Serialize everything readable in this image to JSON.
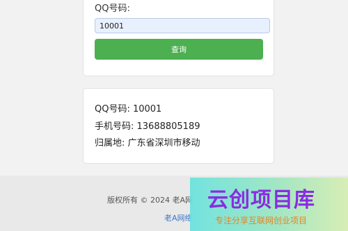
{
  "form": {
    "label": "QQ号码:",
    "input_value": "10001",
    "button_label": "查询"
  },
  "result": {
    "qq": "QQ号码: 10001",
    "phone": "手机号码: 13688805189",
    "location": "归属地: 广东省深圳市移动"
  },
  "footer": {
    "copyright": "版权所有 © 2024 老A网",
    "link_text": "老A网络"
  },
  "watermark": {
    "title": "云创项目库",
    "subtitle": "专注分享互联网创业项目"
  },
  "colors": {
    "button": "#4caf50",
    "input_background": "#e8f0fe",
    "link": "#3a74c8",
    "watermark_title": "#8a2be2",
    "watermark_subtitle": "#e88320"
  }
}
